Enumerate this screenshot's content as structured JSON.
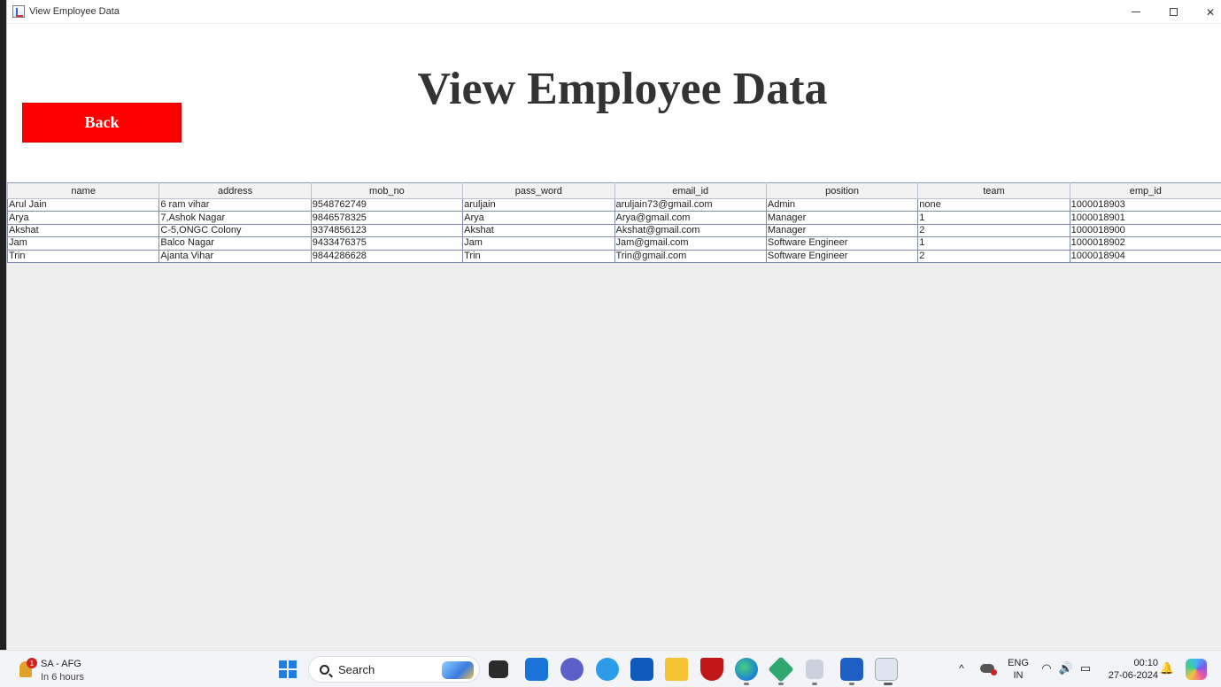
{
  "window": {
    "title": "View Employee Data",
    "controls": {
      "minimize": "minimize-icon",
      "maximize": "maximize-icon",
      "close": "close-icon"
    }
  },
  "page": {
    "heading": "View Employee Data",
    "back_label": "Back",
    "back_color": "#ff0000"
  },
  "table": {
    "columns": [
      "name",
      "address",
      "mob_no",
      "pass_word",
      "email_id",
      "position",
      "team",
      "emp_id"
    ],
    "rows": [
      [
        "Arul Jain",
        "6 ram vihar",
        "9548762749",
        "aruljain",
        "aruljain73@gmail.com",
        "Admin",
        "none",
        "1000018903"
      ],
      [
        "Arya",
        "7,Ashok Nagar",
        "9846578325",
        "Arya",
        "Arya@gmail.com",
        "Manager",
        "1",
        "1000018901"
      ],
      [
        "Akshat",
        "C-5,ONGC Colony",
        "9374856123",
        "Akshat",
        "Akshat@gmail.com",
        "Manager",
        "2",
        "1000018900"
      ],
      [
        "Jam",
        "Balco Nagar",
        "9433476375",
        "Jam",
        "Jam@gmail.com",
        "Software Engineer",
        "1",
        "1000018902"
      ],
      [
        "Trin",
        "Ajanta Vihar",
        "9844286628",
        "Trin",
        "Trin@gmail.com",
        "Software Engineer",
        "2",
        "1000018904"
      ]
    ]
  },
  "taskbar": {
    "weather": {
      "badge": "1",
      "line1": "SA - AFG",
      "line2": "In 6 hours"
    },
    "search_label": "Search",
    "tray": {
      "chevron": "^",
      "lang_top": "ENG",
      "lang_bottom": "IN",
      "time": "00:10",
      "date": "27-06-2024",
      "wifi_glyph": "◠",
      "volume_glyph": "🔊",
      "battery_glyph": "▭",
      "bell_glyph": "🔔"
    }
  }
}
